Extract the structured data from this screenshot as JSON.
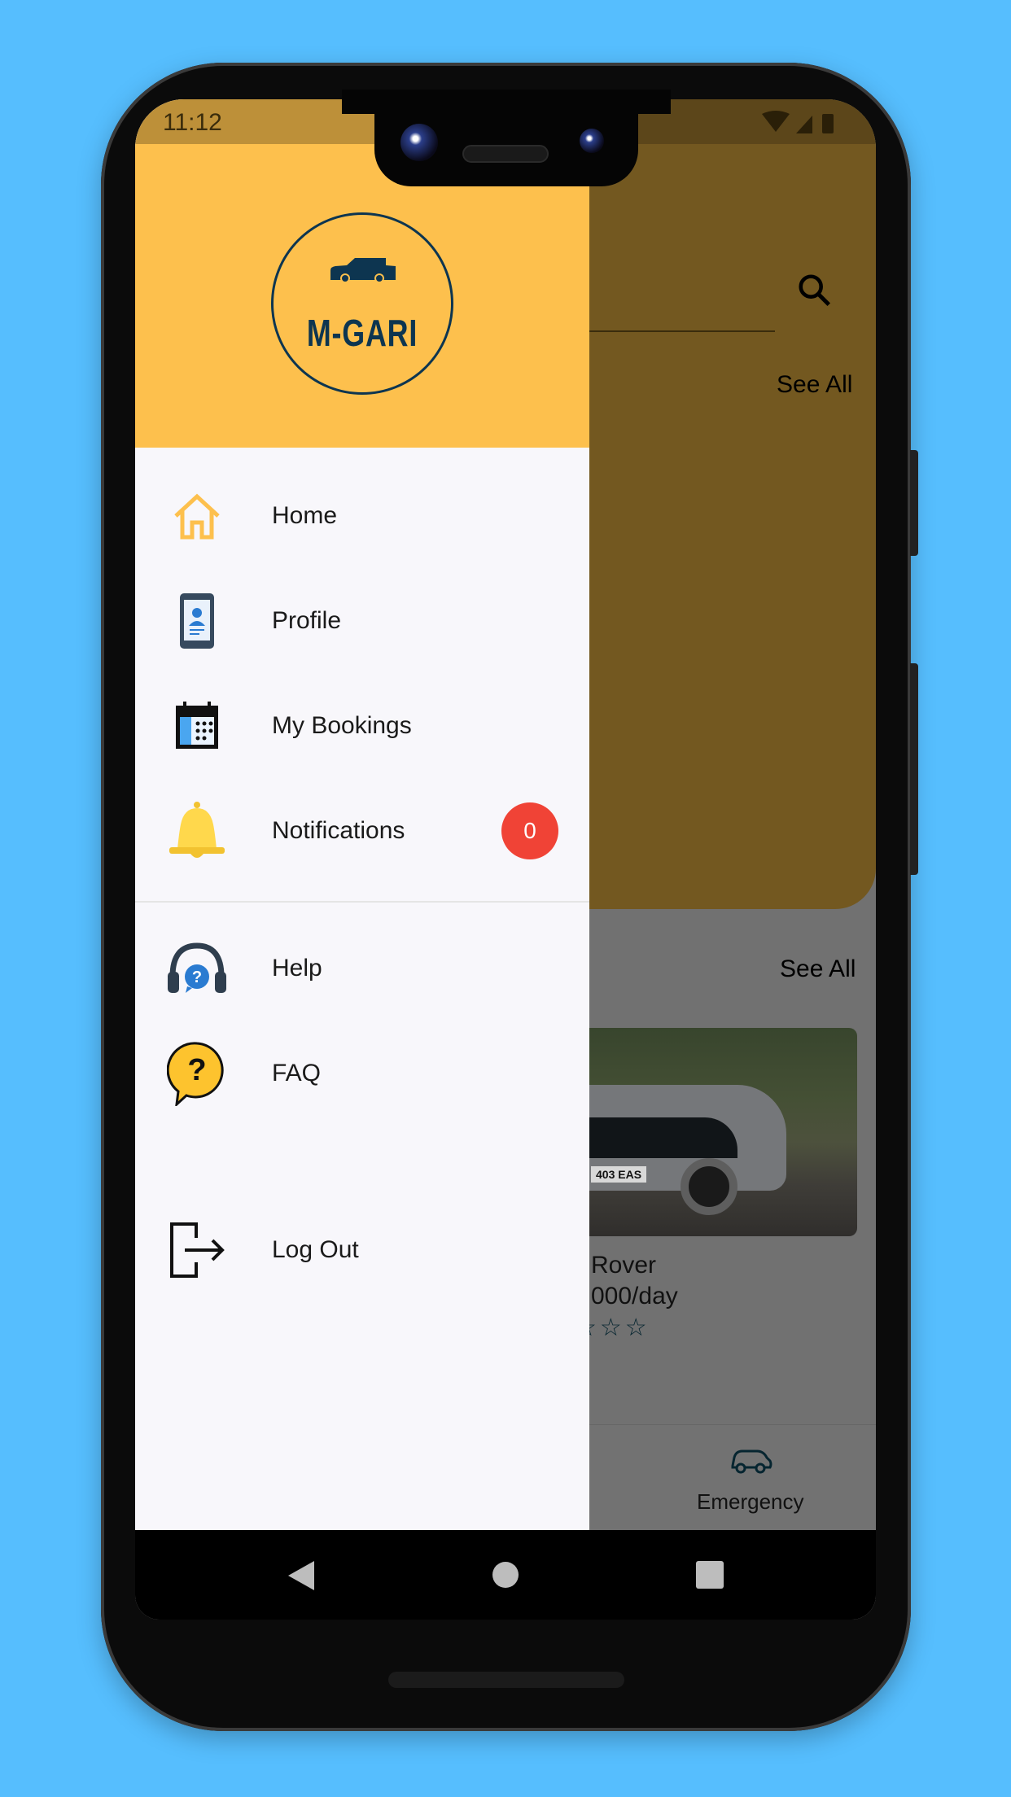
{
  "status_bar": {
    "time": "11:12"
  },
  "background_app": {
    "see_all_1": "See All",
    "see_all_2": "See All",
    "card": {
      "name_partial": "Rover",
      "price_partial": "000/day",
      "plate": "403 EAS",
      "stars": "☆☆☆"
    },
    "bottom_nav": {
      "emergency_label": "Emergency"
    }
  },
  "drawer": {
    "logo_text": "M-GARI",
    "items": [
      {
        "label": "Home",
        "icon": "home-icon"
      },
      {
        "label": "Profile",
        "icon": "profile-icon"
      },
      {
        "label": "My Bookings",
        "icon": "calendar-icon"
      },
      {
        "label": "Notifications",
        "icon": "bell-icon",
        "badge": "0"
      },
      {
        "label": "Help",
        "icon": "headset-help-icon"
      },
      {
        "label": "FAQ",
        "icon": "question-bubble-icon"
      },
      {
        "label": "Log Out",
        "icon": "logout-icon"
      }
    ]
  },
  "colors": {
    "accent": "#FDC04D",
    "brand": "#0D3550",
    "badge": "#F04336",
    "background": "#56BEFE"
  }
}
